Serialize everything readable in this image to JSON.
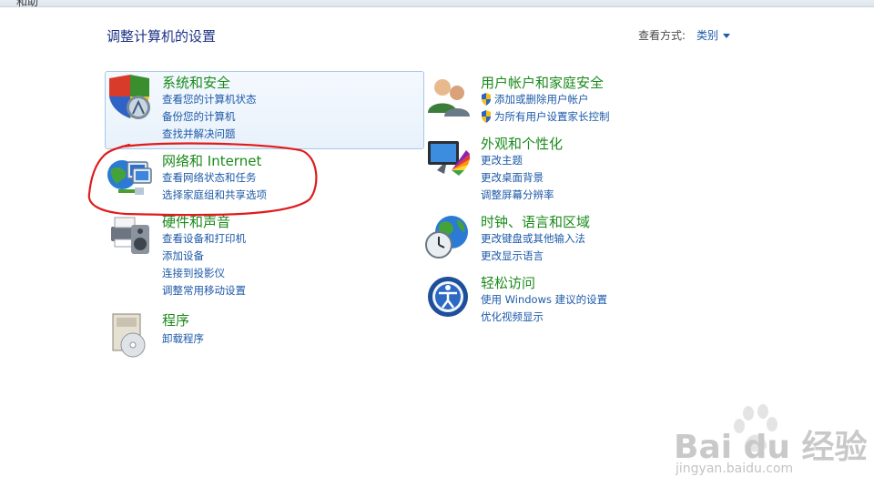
{
  "window": {
    "title_clip": "和助"
  },
  "page_title": "调整计算机的设置",
  "view_by": {
    "label": "查看方式:",
    "value": "类别"
  },
  "categories": [
    {
      "title": "系统和安全",
      "icon": "shield-computer-icon",
      "links": [
        "查看您的计算机状态",
        "备份您的计算机",
        "查找并解决问题"
      ]
    },
    {
      "title": "网络和 Internet",
      "icon": "network-globe-icon",
      "links": [
        "查看网络状态和任务",
        "选择家庭组和共享选项"
      ]
    },
    {
      "title": "硬件和声音",
      "icon": "printer-speaker-icon",
      "links": [
        "查看设备和打印机",
        "添加设备",
        "连接到投影仪",
        "调整常用移动设置"
      ]
    },
    {
      "title": "程序",
      "icon": "programs-disc-icon",
      "links": [
        "卸载程序"
      ]
    },
    {
      "title": "用户帐户和家庭安全",
      "icon": "users-icon",
      "links": [
        "添加或删除用户帐户",
        "为所有用户设置家长控制"
      ]
    },
    {
      "title": "外观和个性化",
      "icon": "monitor-color-icon",
      "links": [
        "更改主题",
        "更改桌面背景",
        "调整屏幕分辨率"
      ]
    },
    {
      "title": "时钟、语言和区域",
      "icon": "globe-clock-icon",
      "links": [
        "更改键盘或其他输入法",
        "更改显示语言"
      ]
    },
    {
      "title": "轻松访问",
      "icon": "ease-of-access-icon",
      "links": [
        "使用 Windows 建议的设置",
        "优化视频显示"
      ]
    }
  ],
  "annotation": {
    "color": "#e01b1b"
  },
  "watermark": {
    "brand": "Bai du 经验",
    "url": "jingyan.baidu.com"
  },
  "colors": {
    "title_blue": "#1e3287",
    "category_green": "#1a8a1a",
    "link_blue": "#1e5aa8"
  }
}
